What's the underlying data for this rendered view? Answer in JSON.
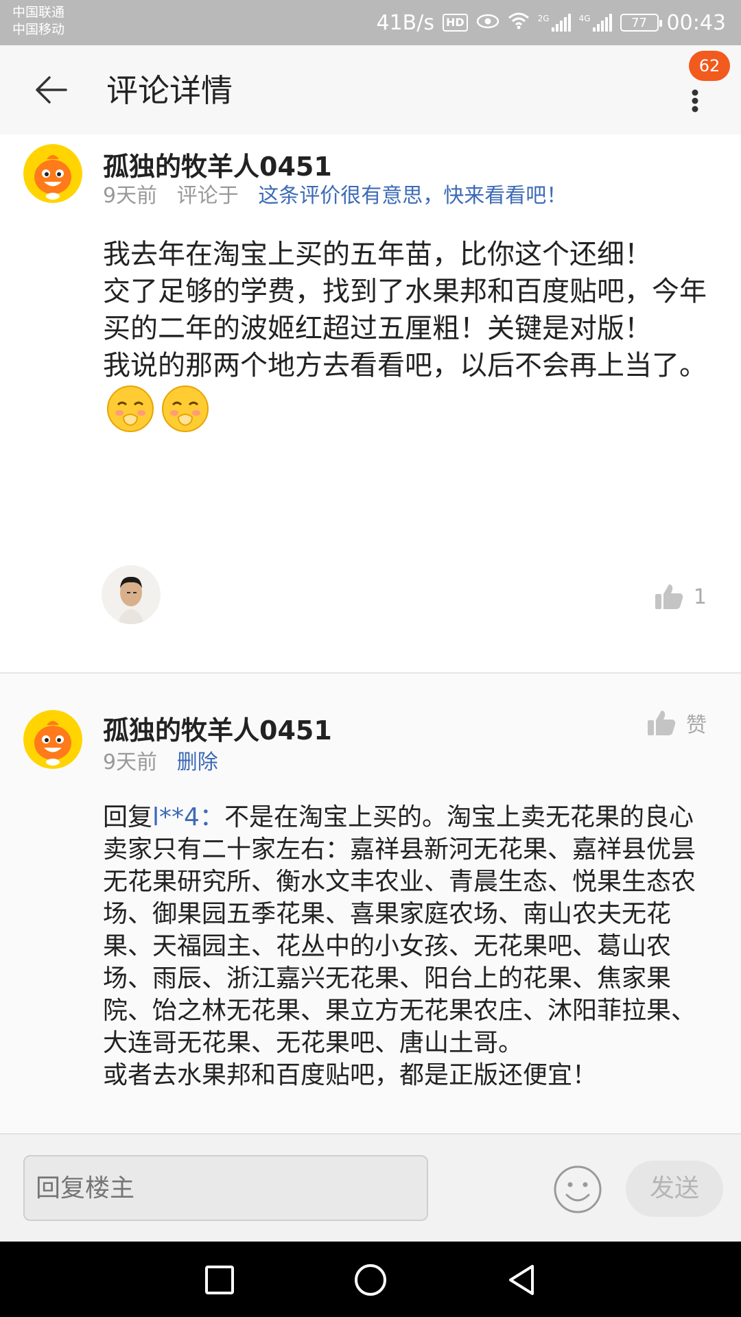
{
  "status_bar": {
    "carrier1": "中国联通",
    "carrier2": "中国移动",
    "net_speed": "41B/s",
    "hd_label": "HD",
    "signal1_tag": "2G",
    "signal2_tag": "4G",
    "battery": "77",
    "time": "00:43"
  },
  "header": {
    "title": "评论详情",
    "badge_count": "62"
  },
  "main_comment": {
    "username": "孤独的牧羊人0451",
    "time": "9天前",
    "commented_on_label": "评论于",
    "target_link": "这条评价很有意思，快来看看吧！",
    "text": "我去年在淘宝上买的五年苗，比你这个还细！\n交了足够的学费，找到了水果邦和百度贴吧，今年买的二年的波姬红超过五厘粗！关键是对版！\n我说的那两个地方去看看吧，以后不会再上当了。",
    "emojis": [
      "laughing-emoji",
      "laughing-emoji"
    ],
    "like_count": "1"
  },
  "reply_comment": {
    "username": "孤独的牧羊人0451",
    "time": "9天前",
    "delete_label": "删除",
    "like_label": "赞",
    "reply_prefix": "回复",
    "reply_to": "l**4：",
    "text": "不是在淘宝上买的。淘宝上卖无花果的良心卖家只有二十家左右：嘉祥县新河无花果、嘉祥县优昙无花果研究所、衡水文丰农业、青晨生态、悦果生态农场、御果园五季花果、喜果家庭农场、南山农夫无花果、天福园主、花丛中的小女孩、无花果吧、葛山农场、雨辰、浙江嘉兴无花果、阳台上的花果、焦家果院、饴之林无花果、果立方无花果农庄、沐阳菲拉果、大连哥无花果、无花果吧、唐山土哥。\n或者去水果邦和百度贴吧，都是正版还便宜！"
  },
  "reply_bar": {
    "placeholder": "回复楼主",
    "send_label": "发送"
  }
}
